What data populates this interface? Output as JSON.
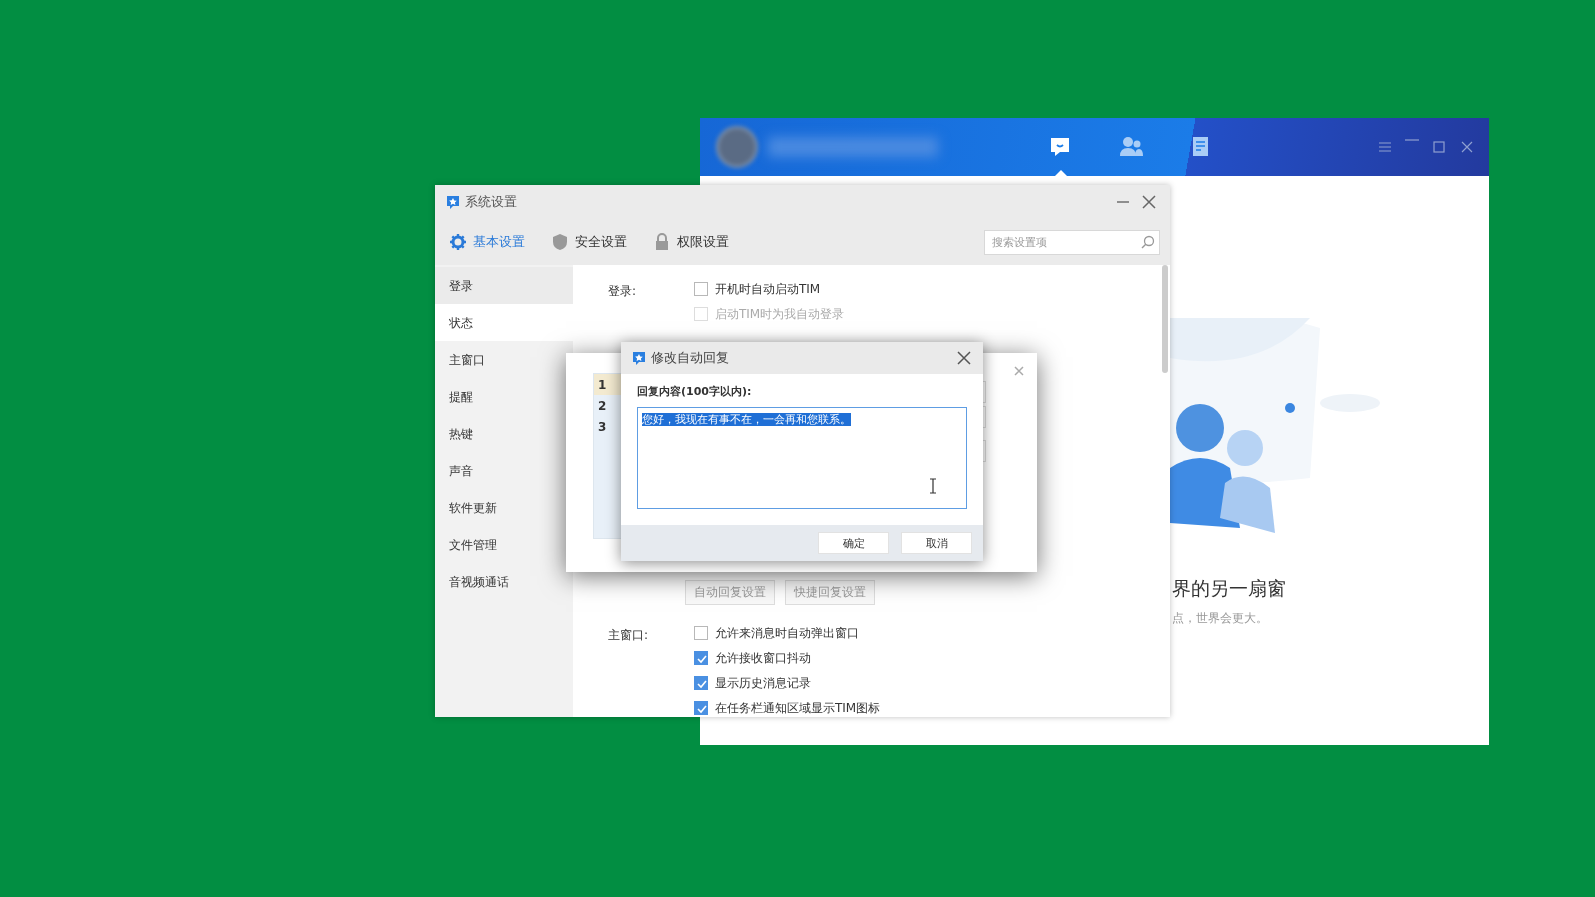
{
  "main_window": {
    "nav": [
      {
        "kind": "chat",
        "selected": true
      },
      {
        "kind": "contacts",
        "selected": false
      },
      {
        "kind": "files",
        "selected": false
      }
    ],
    "headline": "界的另一扇窗",
    "subline": "点，世界会更大。"
  },
  "settings_window": {
    "title": "系统设置",
    "tabs": [
      {
        "kind": "gear",
        "label": "基本设置",
        "selected": true
      },
      {
        "kind": "shield",
        "label": "安全设置",
        "selected": false
      },
      {
        "kind": "lock",
        "label": "权限设置",
        "selected": false
      }
    ],
    "search": {
      "placeholder": "搜索设置项"
    },
    "sidebar": {
      "items": [
        {
          "label": "登录",
          "selected": false
        },
        {
          "label": "状态",
          "selected": true
        },
        {
          "label": "主窗口",
          "selected": false
        },
        {
          "label": "提醒",
          "selected": false
        },
        {
          "label": "热键",
          "selected": false
        },
        {
          "label": "声音",
          "selected": false
        },
        {
          "label": "软件更新",
          "selected": false
        },
        {
          "label": "文件管理",
          "selected": false
        },
        {
          "label": "音视频通话",
          "selected": false
        }
      ]
    },
    "login": {
      "label": "登录:",
      "options": [
        {
          "label": "开机时自动启动TIM",
          "checked": false,
          "disabled": false
        },
        {
          "label": "启动TIM时为我自动登录",
          "checked": false,
          "disabled": true
        }
      ]
    },
    "reply_buttons": [
      "自动回复设置",
      "快捷回复设置"
    ],
    "main": {
      "label": "主窗口:",
      "options": [
        {
          "label": "允许来消息时自动弹出窗口",
          "checked": false,
          "disabled": false
        },
        {
          "label": "允许接收窗口抖动",
          "checked": true,
          "disabled": false
        },
        {
          "label": "显示历史消息记录",
          "checked": true,
          "disabled": false
        },
        {
          "label": "在任务栏通知区域显示TIM图标",
          "checked": true,
          "disabled": false
        }
      ]
    }
  },
  "reply_list_dialog": {
    "rows": [
      {
        "label": "1",
        "selected": true
      },
      {
        "label": "2",
        "selected": false
      },
      {
        "label": "3",
        "selected": false
      }
    ]
  },
  "auto_reply_dialog": {
    "title": "修改自动回复",
    "field_label": "回复内容(100字以内):",
    "value": "您好，我现在有事不在，一会再和您联系。",
    "value_selected": true,
    "buttons": [
      "确定",
      "取消"
    ]
  }
}
